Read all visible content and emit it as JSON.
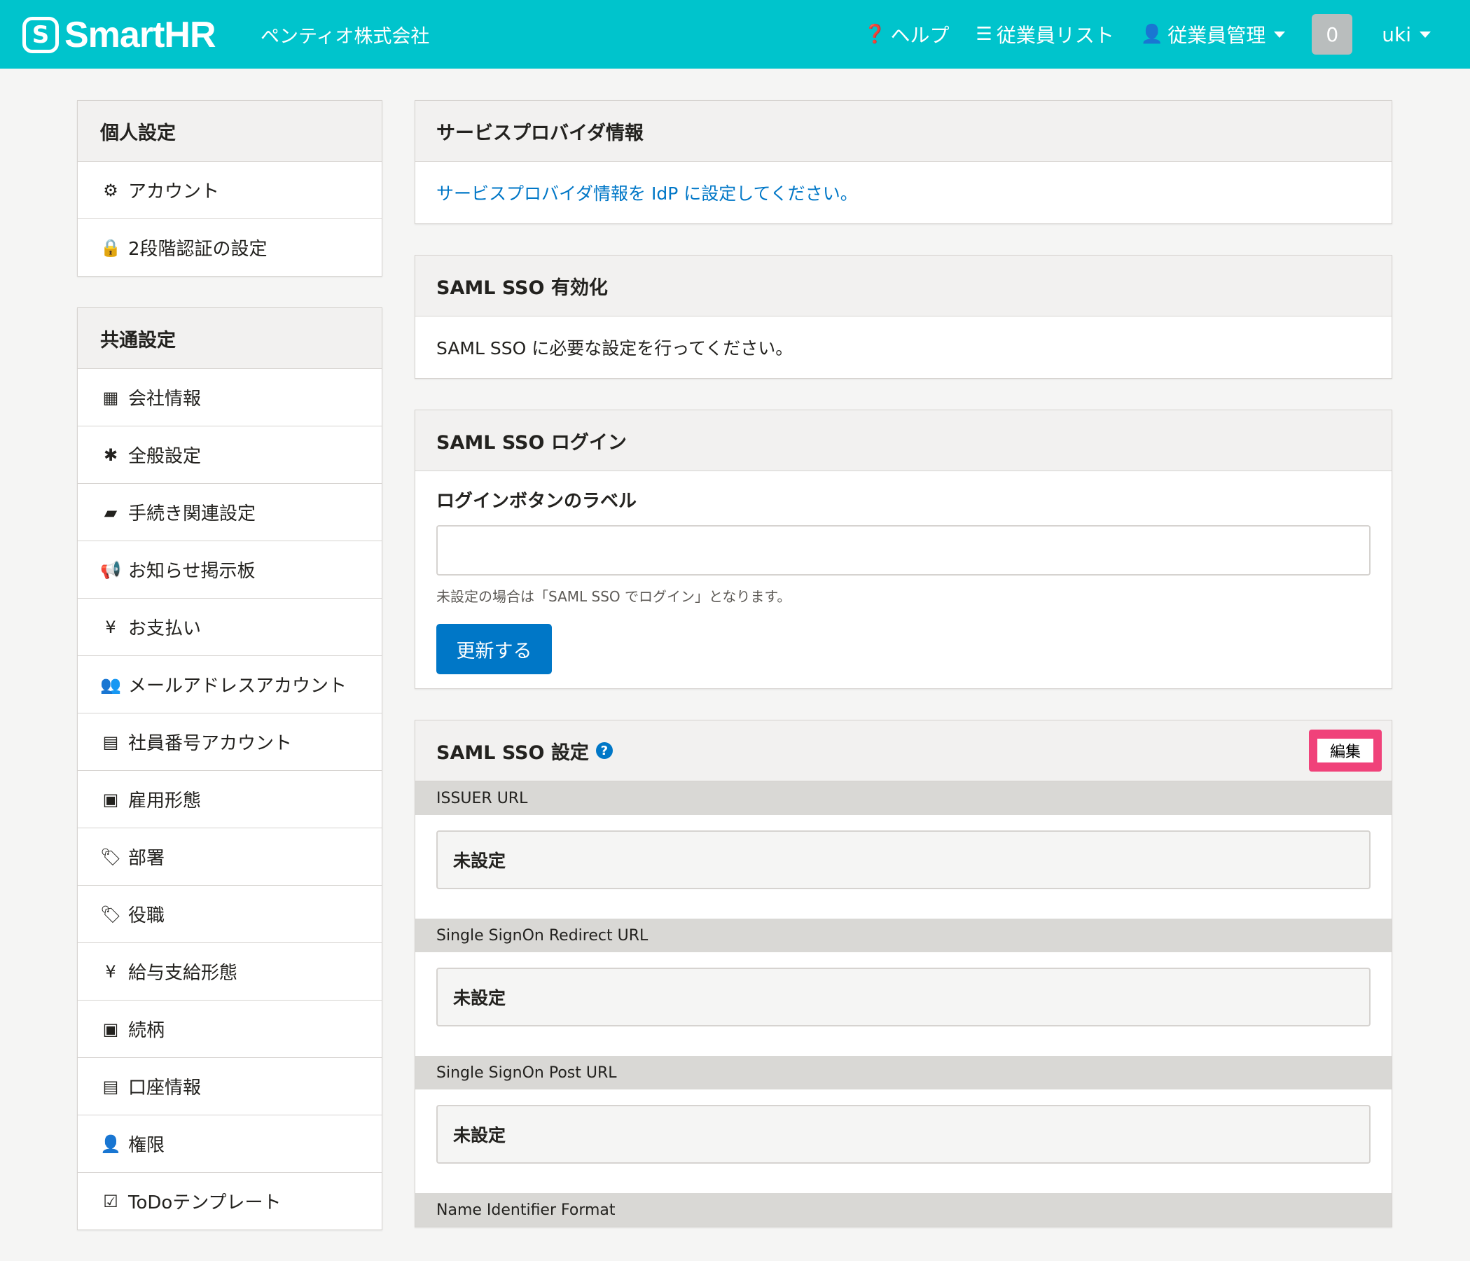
{
  "header": {
    "logo_mark": "S",
    "logo_text": "SmartHR",
    "company": "ペンティオ株式会社",
    "help": "ヘルプ",
    "employee_list": "従業員リスト",
    "employee_management": "従業員管理",
    "notification_count": "0",
    "user": "uki"
  },
  "sidebar": {
    "personal": {
      "title": "個人設定",
      "items": [
        {
          "label": "アカウント",
          "icon": "gear-icon",
          "glyph": "⚙"
        },
        {
          "label": "2段階認証の設定",
          "icon": "lock-icon",
          "glyph": "🔒"
        }
      ]
    },
    "common": {
      "title": "共通設定",
      "items": [
        {
          "label": "会社情報",
          "icon": "building-icon",
          "glyph": "▦"
        },
        {
          "label": "全般設定",
          "icon": "asterisk-icon",
          "glyph": "✱"
        },
        {
          "label": "手続き関連設定",
          "icon": "book-icon",
          "glyph": "▰"
        },
        {
          "label": "お知らせ掲示板",
          "icon": "bullhorn-icon",
          "glyph": "📢"
        },
        {
          "label": "お支払い",
          "icon": "yen-icon",
          "glyph": "¥"
        },
        {
          "label": "メールアドレスアカウント",
          "icon": "users-icon",
          "glyph": "👥"
        },
        {
          "label": "社員番号アカウント",
          "icon": "id-card-icon",
          "glyph": "▤"
        },
        {
          "label": "雇用形態",
          "icon": "badge-icon",
          "glyph": "▣"
        },
        {
          "label": "部署",
          "icon": "tags-icon",
          "glyph": "🏷"
        },
        {
          "label": "役職",
          "icon": "tag-icon",
          "glyph": "🏷"
        },
        {
          "label": "給与支給形態",
          "icon": "yen-circle-icon",
          "glyph": "¥"
        },
        {
          "label": "続柄",
          "icon": "contact-icon",
          "glyph": "▣"
        },
        {
          "label": "口座情報",
          "icon": "list-alt-icon",
          "glyph": "▤"
        },
        {
          "label": "権限",
          "icon": "user-key-icon",
          "glyph": "👤"
        },
        {
          "label": "ToDoテンプレート",
          "icon": "check-square-icon",
          "glyph": "☑"
        }
      ]
    }
  },
  "sp_info": {
    "title": "サービスプロバイダ情報",
    "link": "サービスプロバイダ情報を IdP に設定してください。"
  },
  "enable": {
    "title": "SAML SSO 有効化",
    "text": "SAML SSO に必要な設定を行ってください。"
  },
  "login": {
    "title": "SAML SSO ログイン",
    "field_label": "ログインボタンのラベル",
    "value": "",
    "hint": "未設定の場合は「SAML SSO でログイン」となります。",
    "submit": "更新する"
  },
  "settings": {
    "title": "SAML SSO 設定",
    "edit": "編集",
    "fields": [
      {
        "label": "ISSUER URL",
        "value": "未設定"
      },
      {
        "label": "Single SignOn Redirect URL",
        "value": "未設定"
      },
      {
        "label": "Single SignOn Post URL",
        "value": "未設定"
      },
      {
        "label": "Name Identifier Format",
        "value": ""
      }
    ]
  },
  "colors": {
    "brand": "#00c4cc",
    "primary": "#0077c7",
    "highlight": "#f0427a"
  }
}
